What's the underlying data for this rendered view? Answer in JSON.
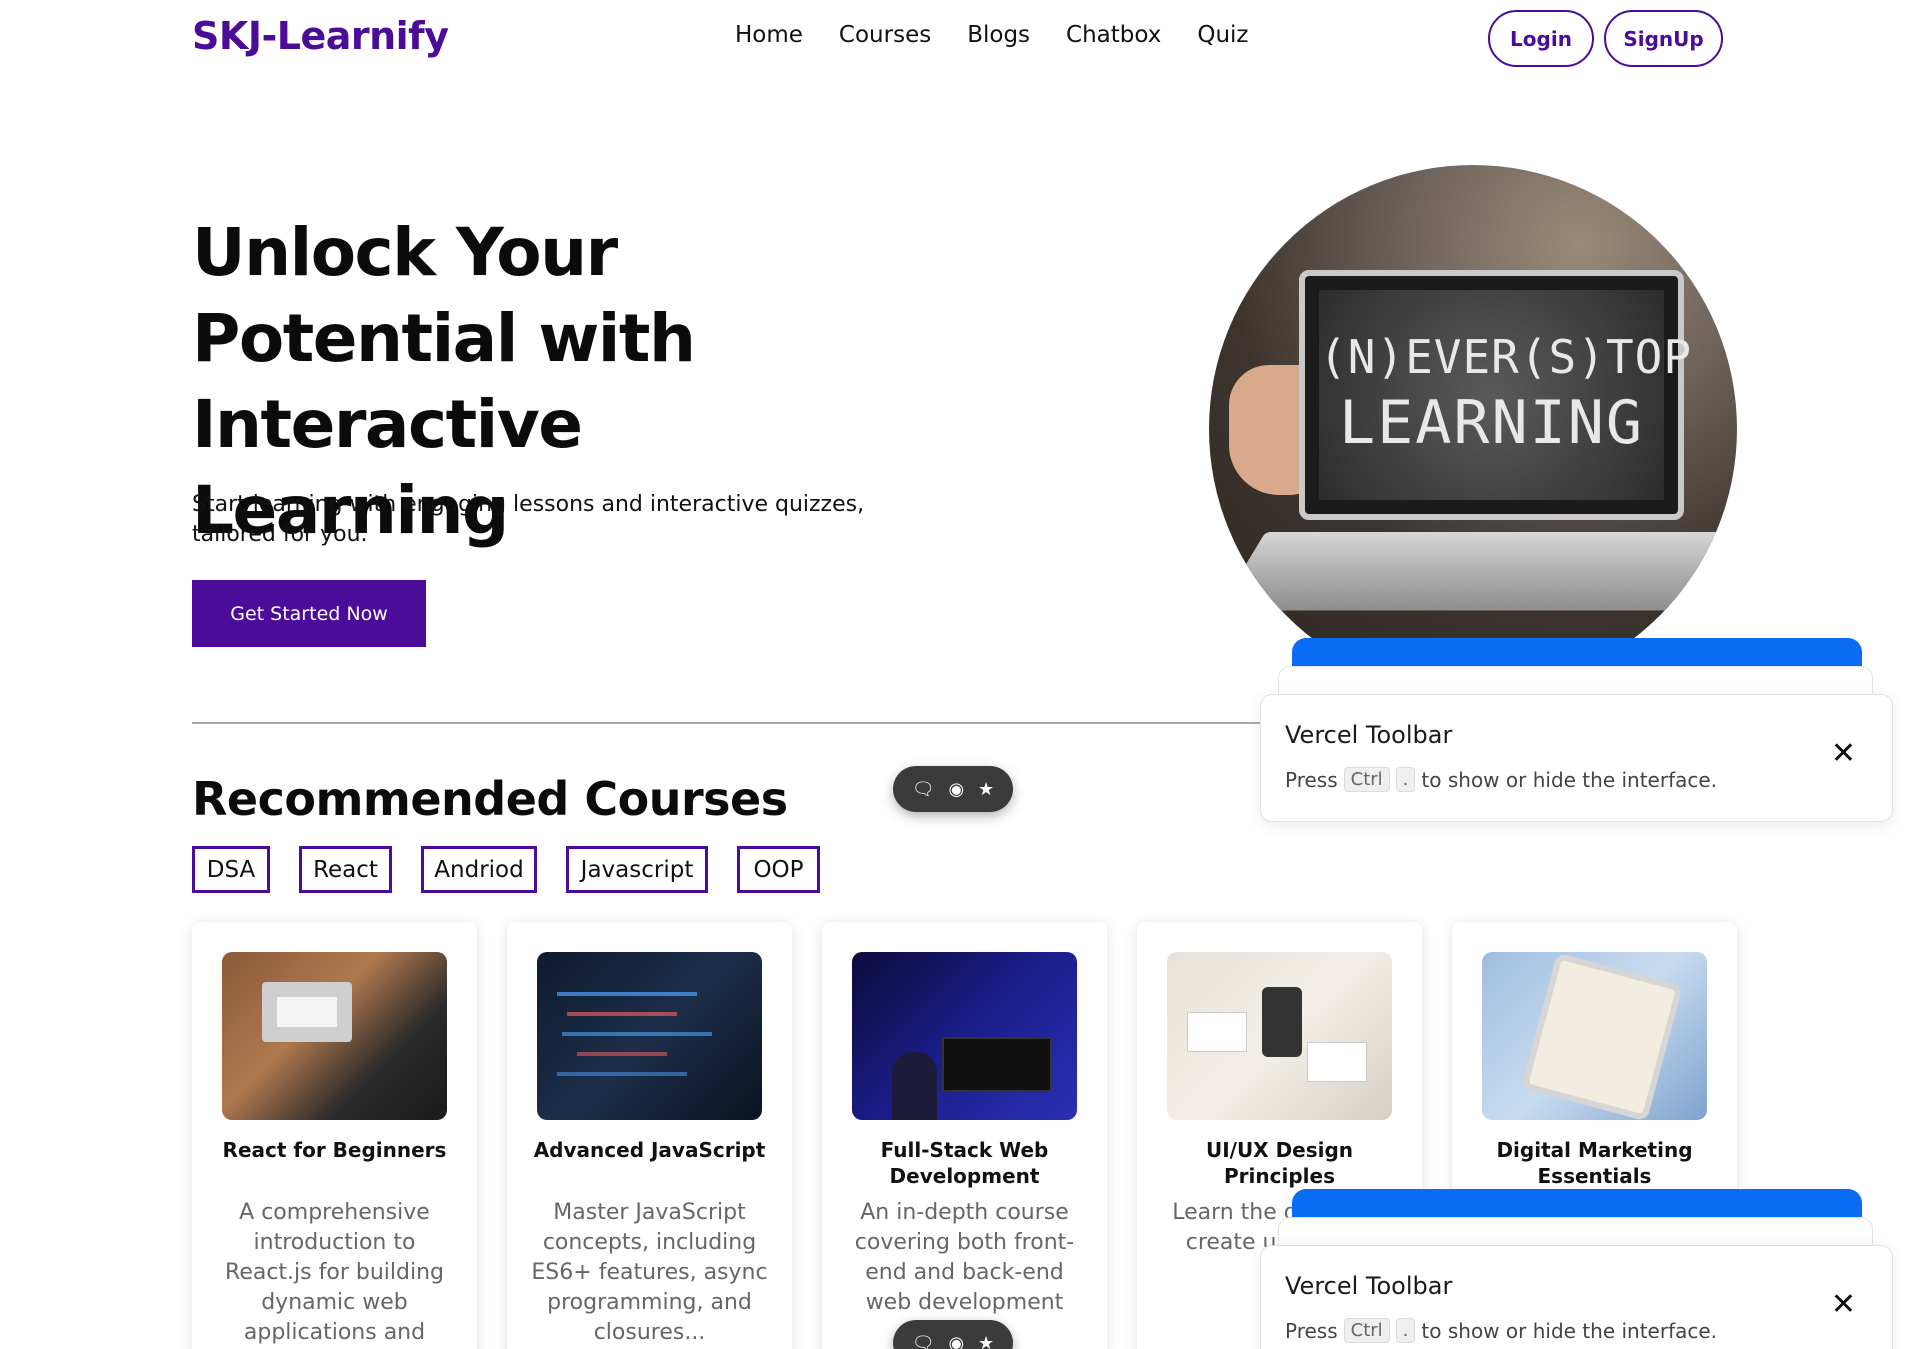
{
  "brand": {
    "logo": "SKJ-Learnify",
    "accent": "#4b0c9a"
  },
  "nav": {
    "items": [
      "Home",
      "Courses",
      "Blogs",
      "Chatbox",
      "Quiz"
    ]
  },
  "auth": {
    "login": "Login",
    "signup": "SignUp"
  },
  "hero": {
    "title": "Unlock Your Potential with Interactive Learning",
    "subtitle": "Start learning with engaging lessons and interactive quizzes, tailored for you.",
    "cta": "Get Started Now",
    "image_chalk_line1": "(N)EVER(S)TOP",
    "image_chalk_line2": "LEARNING"
  },
  "courses": {
    "heading": "Recommended Courses",
    "tags": [
      "DSA",
      "React",
      "Andriod",
      "Javascript",
      "OOP"
    ],
    "cards": [
      {
        "title": "React for Beginners",
        "desc": "A comprehensive introduction to React.js for building dynamic web applications and"
      },
      {
        "title": "Advanced JavaScript",
        "desc": "Master JavaScript concepts, including ES6+ features, async programming, and closures..."
      },
      {
        "title": "Full-Stack Web Development",
        "desc": "An in-depth course covering both front-end and back-end web development"
      },
      {
        "title": "UI/UX Design Principles",
        "desc": "Learn the design pr create u and app"
      },
      {
        "title": "Digital Marketing Essentials",
        "desc": ""
      }
    ]
  },
  "vercel": {
    "title": "Vercel Toolbar",
    "press": "Press",
    "key1": "Ctrl",
    "key2": ".",
    "rest": "to show or hide the interface.",
    "close": "✕",
    "accent": "#0a6cf5"
  },
  "pill": {
    "icons": [
      "comment-icon",
      "eye-icon",
      "accessibility-icon"
    ]
  }
}
